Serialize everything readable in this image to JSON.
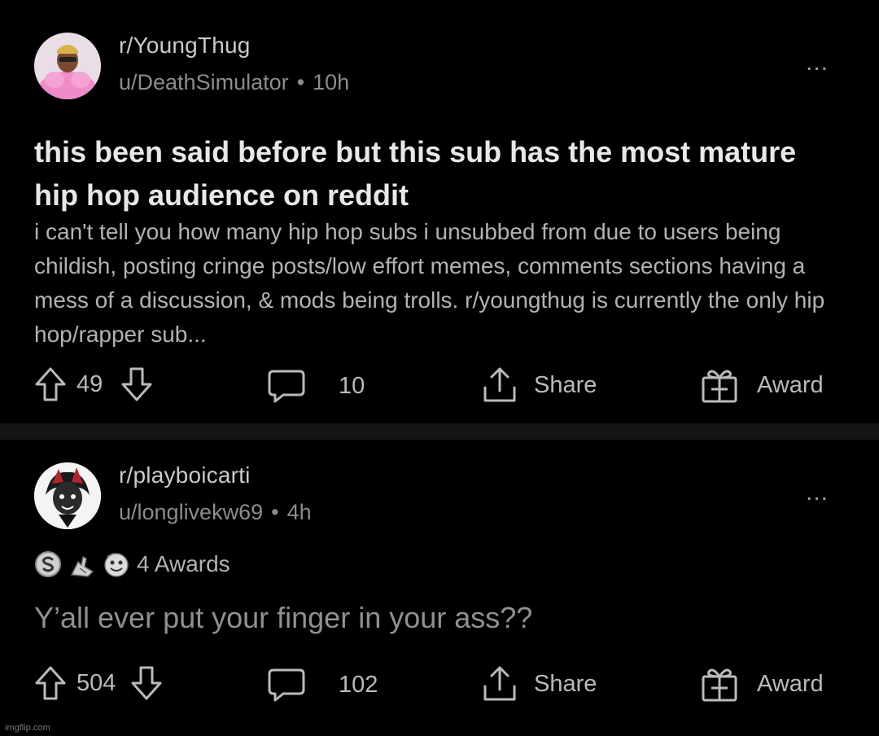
{
  "posts": [
    {
      "subreddit": "r/YoungThug",
      "user": "u/DeathSimulator",
      "dot": "•",
      "time": "10h",
      "more": "...",
      "title": "this been said before but this sub has the most mature hip hop audience on reddit",
      "body": "i can't tell you how many hip hop subs i unsubbed from due to users being childish, posting cringe posts/low effort memes, comments sections having a mess of a discussion, & mods being trolls. r/youngthug is currently the only hip hop/rapper sub...",
      "votes": "49",
      "comments": "10",
      "share_label": "Share",
      "award_label": "Award"
    },
    {
      "subreddit": "r/playboicarti",
      "user": "u/longlivekw69",
      "dot": "•",
      "time": "4h",
      "more": "...",
      "awards_label": "4 Awards",
      "content": "Y’all ever put your finger in your ass??",
      "votes": "504",
      "comments": "102",
      "share_label": "Share",
      "award_label": "Award"
    }
  ],
  "watermark": "imgflip.com",
  "colors": {
    "background": "#000000",
    "divider": "#141414",
    "text_primary": "#e6e8ea",
    "text_secondary": "#8a8c8e"
  },
  "icons": [
    "avatar",
    "more-icon",
    "upvote-icon",
    "downvote-icon",
    "comment-icon",
    "share-icon",
    "award-icon",
    "silver-award-icon",
    "hands-award-icon",
    "face-award-icon"
  ]
}
